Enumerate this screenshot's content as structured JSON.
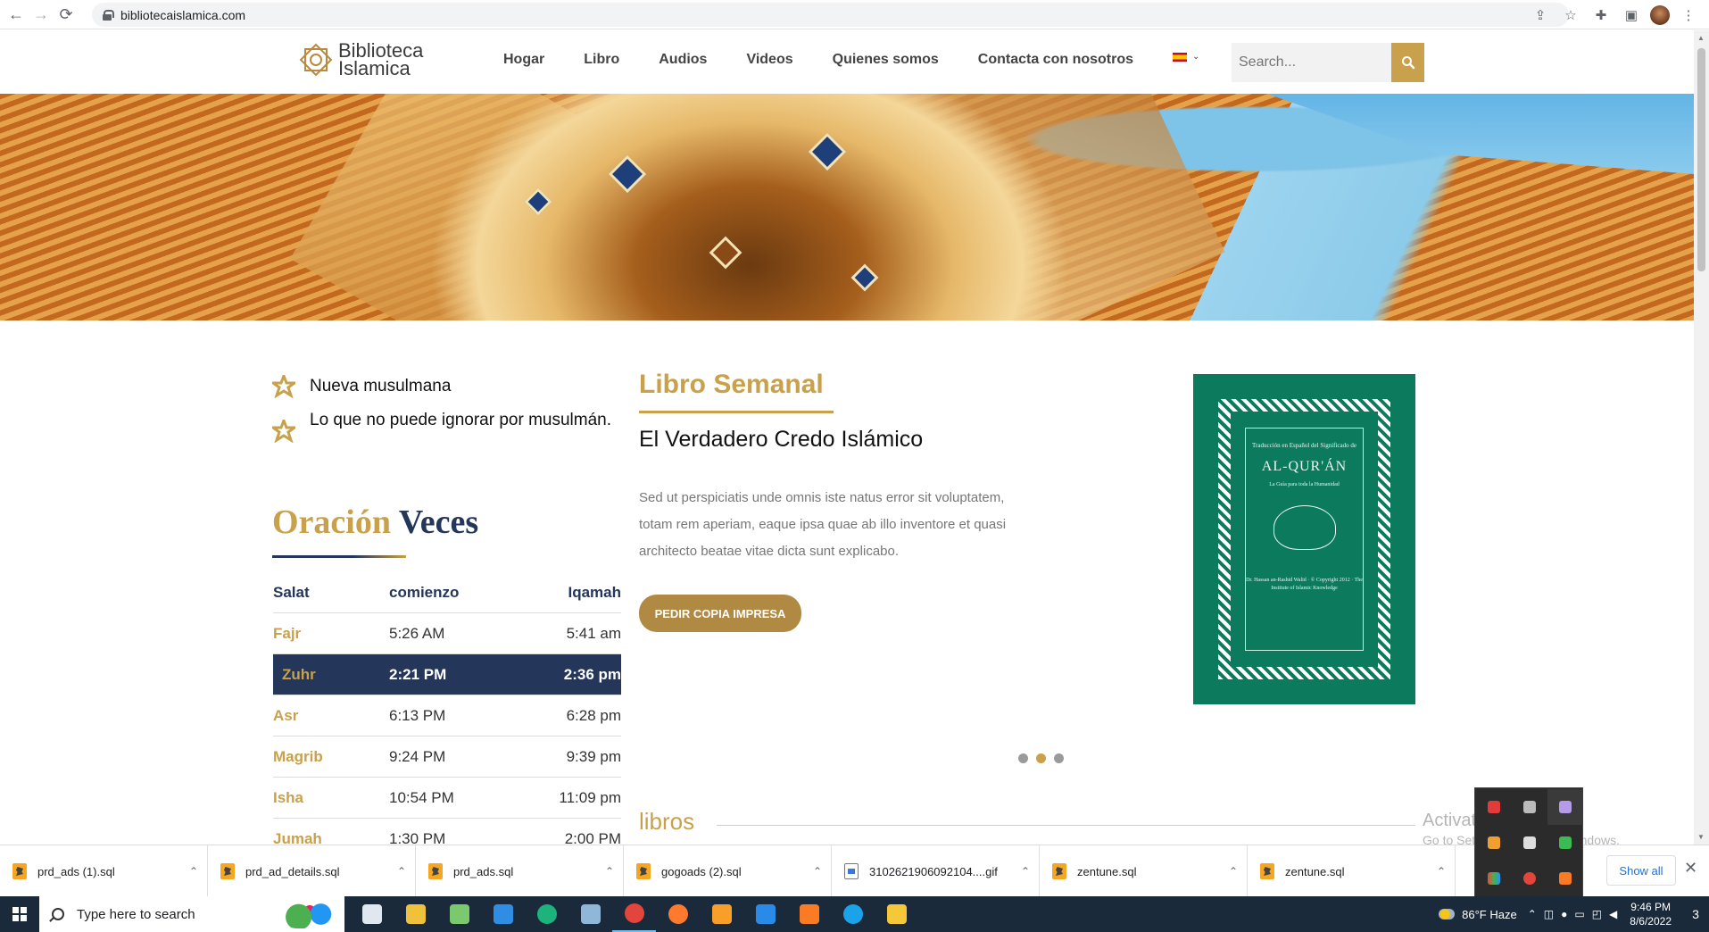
{
  "browser": {
    "url": "bibliotecaislamica.com",
    "back_icon": "arrow-left-icon",
    "forward_icon": "arrow-right-icon",
    "reload_icon": "reload-icon"
  },
  "site": {
    "logo_line1": "Biblioteca",
    "logo_line2": "Islamica",
    "nav": [
      "Hogar",
      "Libro",
      "Audios",
      "Videos",
      "Quienes somos",
      "Contacta con nosotros"
    ],
    "search_placeholder": "Search...",
    "language": "es"
  },
  "links": [
    "Nueva musulmana",
    "Lo que no puede ignorar por musulmán."
  ],
  "prayer": {
    "title_gold": "Oración",
    "title_navy": "Veces",
    "headers": [
      "Salat",
      "comienzo",
      "Iqamah"
    ],
    "rows": [
      {
        "name": "Fajr",
        "start": "5:26 AM",
        "iqamah": "5:41 am"
      },
      {
        "name": "Zuhr",
        "start": "2:21 PM",
        "iqamah": "2:36 pm",
        "active": true
      },
      {
        "name": "Asr",
        "start": "6:13 PM",
        "iqamah": "6:28 pm"
      },
      {
        "name": "Magrib",
        "start": "9:24 PM",
        "iqamah": "9:39 pm"
      },
      {
        "name": "Isha",
        "start": "10:54 PM",
        "iqamah": "11:09 pm"
      },
      {
        "name": "Jumah",
        "start": "1:30 PM",
        "iqamah": "2:00 PM"
      }
    ]
  },
  "weekly": {
    "heading": "Libro Semanal",
    "book_title": "El Verdadero Credo Islámico",
    "description": "Sed ut perspiciatis unde omnis iste natus error sit voluptatem, totam rem aperiam, eaque ipsa quae ab illo inventore et quasi architecto beatae vitae dicta sunt explicabo.",
    "button": "PEDIR COPIA IMPRESA",
    "cover": {
      "small": "Traducción en Español del Significado de",
      "title": "AL-QUR'ÁN",
      "subtitle": "La Guía para toda la Humanidad",
      "footer": "Dr. Hassan an-Rashid Walid · © Copyright 2012 · The Institute of Islamic Knowledge"
    },
    "slides": 3,
    "active_slide": 2
  },
  "books_heading": "libros",
  "watermark": {
    "line1": "Activate Windows",
    "line2": "Go to Settings to activate Windows."
  },
  "downloads": {
    "items": [
      {
        "name": "prd_ads (1).sql",
        "kind": "sql"
      },
      {
        "name": "prd_ad_details.sql",
        "kind": "sql"
      },
      {
        "name": "prd_ads.sql",
        "kind": "sql"
      },
      {
        "name": "gogoads (2).sql",
        "kind": "sql"
      },
      {
        "name": "3102621906092104....gif",
        "kind": "file"
      },
      {
        "name": "zentune.sql",
        "kind": "sql"
      },
      {
        "name": "zentune.sql",
        "kind": "sql"
      }
    ],
    "show_all": "Show all"
  },
  "taskbar": {
    "search_placeholder": "Type here to search",
    "weather": "86°F  Haze",
    "time": "9:46 PM",
    "date": "8/6/2022",
    "notifications": "3",
    "apps": [
      {
        "icon": "task-view-icon",
        "color": "#dfe7f0"
      },
      {
        "icon": "file-explorer-icon",
        "color": "#f0c23b"
      },
      {
        "icon": "notepad-icon",
        "color": "#7bc96f"
      },
      {
        "icon": "mail-icon",
        "color": "#2f8de4"
      },
      {
        "icon": "edge-icon",
        "color": "#1db37c"
      },
      {
        "icon": "app-icon",
        "color": "#8fb8d8"
      },
      {
        "icon": "chrome-icon",
        "color": "#e2453c"
      },
      {
        "icon": "firefox-icon",
        "color": "#ff7a2f"
      },
      {
        "icon": "sublime-icon",
        "color": "#f89f29"
      },
      {
        "icon": "vscode-icon",
        "color": "#2a8ae8"
      },
      {
        "icon": "xampp-icon",
        "color": "#fb7a24"
      },
      {
        "icon": "skype-icon",
        "color": "#1aa3e8"
      },
      {
        "icon": "git-icon",
        "color": "#f5c83a"
      }
    ]
  },
  "colors": {
    "gold": "#c9a04b",
    "navy": "#24365a",
    "button": "#b08a42",
    "book_green": "#0b7a5d"
  }
}
